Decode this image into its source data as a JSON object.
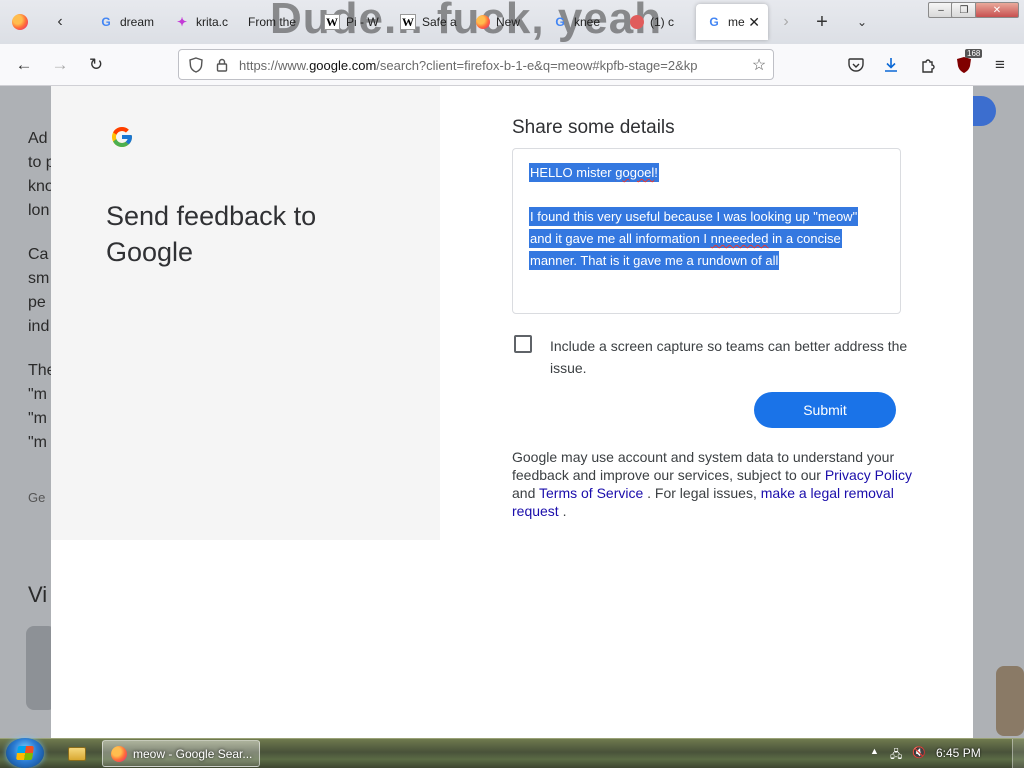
{
  "browser": {
    "tabs": [
      {
        "title": "dream",
        "icon": "google-icon"
      },
      {
        "title": "krita.c",
        "icon": "krita-icon"
      },
      {
        "title": "From the",
        "icon": "image-thumbnail"
      },
      {
        "title": "Pi - W",
        "icon": "wikipedia-icon"
      },
      {
        "title": "Safe a",
        "icon": "wikipedia-icon"
      },
      {
        "title": "New",
        "icon": "firefox-icon"
      },
      {
        "title": "knee",
        "icon": "google-icon"
      },
      {
        "title": "(1) c",
        "icon": "reddit-icon"
      },
      {
        "title": "me",
        "icon": "google-icon",
        "active": true
      }
    ],
    "background_overlay_text": "Dude... fuck, yeah",
    "url_prefix": "https://www.",
    "url_host": "google.com",
    "url_rest": "/search?client=firefox-b-1-e&q=meow#kpfb-stage=2&kp",
    "extension_badge": "168"
  },
  "background_page": {
    "fragments": [
      "Ad",
      "to p",
      "kno",
      "lon",
      "Ca",
      "sm",
      "pe",
      "ind",
      "The",
      "\"m",
      "\"m",
      "\"m",
      "Ge",
      "Vi"
    ]
  },
  "dialog": {
    "title": "Send feedback to Google",
    "details_heading": "Share some details",
    "feedback_text": {
      "line1_before": "HELLO mister ",
      "line1_misspelled": "gogoel",
      "line1_after": "!",
      "para2": [
        "I found this very useful because I was looking up \"meow\"",
        "and it gave me all information I ",
        "manner. That is it gave me a rundown of all"
      ],
      "para2_misspelled": "nneeeded",
      "para2_line2_after": " in a concise"
    },
    "checkbox_label": "Include a screen capture so teams can better address the issue.",
    "checkbox_checked": false,
    "submit_label": "Submit",
    "legal_text_1": "Google may use account and system data to understand your feedback and improve our services, subject to our ",
    "privacy_link": "Privacy Policy",
    "legal_and": " and ",
    "terms_link": "Terms of Service",
    "legal_text_2": " . For legal issues, ",
    "legal_request_link": "make a legal removal request",
    "legal_end": " ."
  },
  "taskbar": {
    "active_task": "meow - Google Sear...",
    "clock": "6:45 PM"
  },
  "colors": {
    "accent": "#1a73e8",
    "selection": "#3478e0",
    "link": "#1a0dab"
  }
}
